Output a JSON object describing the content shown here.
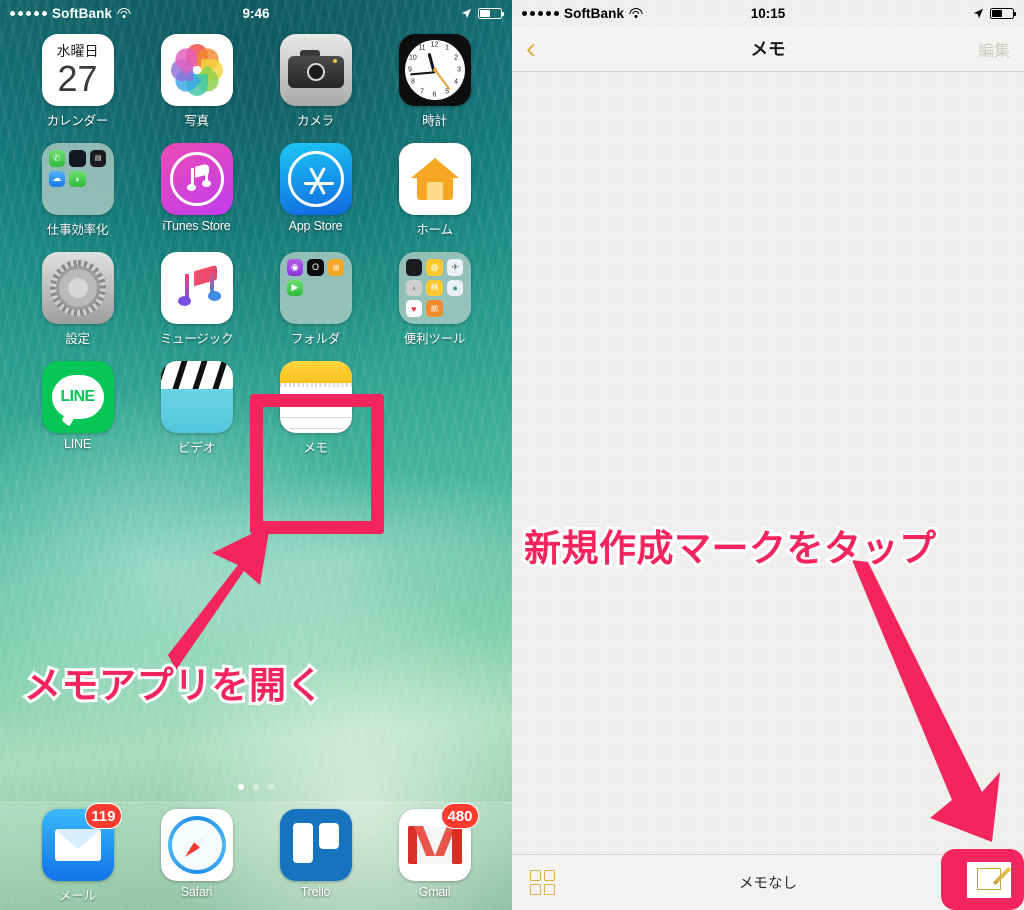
{
  "left_panel": {
    "status_bar": {
      "carrier": "SoftBank",
      "time": "9:46",
      "signal_dots": 5
    },
    "apps_rows": [
      [
        {
          "label": "カレンダー",
          "icon": "calendar-icon",
          "day_of_week": "水曜日",
          "day_number": "27"
        },
        {
          "label": "写真",
          "icon": "photos-icon"
        },
        {
          "label": "カメラ",
          "icon": "camera-icon"
        },
        {
          "label": "時計",
          "icon": "clock-icon"
        }
      ],
      [
        {
          "label": "仕事効率化",
          "icon": "folder-icon"
        },
        {
          "label": "iTunes Store",
          "icon": "itunes-store-icon"
        },
        {
          "label": "App Store",
          "icon": "app-store-icon"
        },
        {
          "label": "ホーム",
          "icon": "home-app-icon"
        }
      ],
      [
        {
          "label": "設定",
          "icon": "settings-icon"
        },
        {
          "label": "ミュージック",
          "icon": "music-icon"
        },
        {
          "label": "フォルダ",
          "icon": "folder-icon"
        },
        {
          "label": "便利ツール",
          "icon": "folder-icon"
        }
      ],
      [
        {
          "label": "LINE",
          "icon": "line-icon"
        },
        {
          "label": "ビデオ",
          "icon": "videos-icon"
        },
        {
          "label": "メモ",
          "icon": "notes-icon"
        }
      ]
    ],
    "page_dots": {
      "count": 3,
      "active_index": 0
    },
    "dock": [
      {
        "label": "メール",
        "icon": "mail-icon",
        "badge": "119"
      },
      {
        "label": "Safari",
        "icon": "safari-icon",
        "badge": ""
      },
      {
        "label": "Trello",
        "icon": "trello-icon",
        "badge": ""
      },
      {
        "label": "Gmail",
        "icon": "gmail-icon",
        "badge": "480"
      }
    ],
    "annotation": {
      "text": "メモアプリを開く",
      "color": "#f4245e"
    }
  },
  "right_panel": {
    "status_bar": {
      "carrier": "SoftBank",
      "time": "10:15",
      "signal_dots": 5
    },
    "navbar": {
      "back_icon": "chevron-left-icon",
      "title": "メモ",
      "edit_label": "編集"
    },
    "toolbar": {
      "grid_icon": "grid-view-icon",
      "status": "メモなし",
      "compose_icon": "compose-note-icon"
    },
    "annotation": {
      "text": "新規作成マークをタップ",
      "color": "#f4245e"
    }
  },
  "colors": {
    "accent_pink": "#f4245e",
    "notes_gold": "#d9b348",
    "badge_red": "#fb3b30"
  }
}
